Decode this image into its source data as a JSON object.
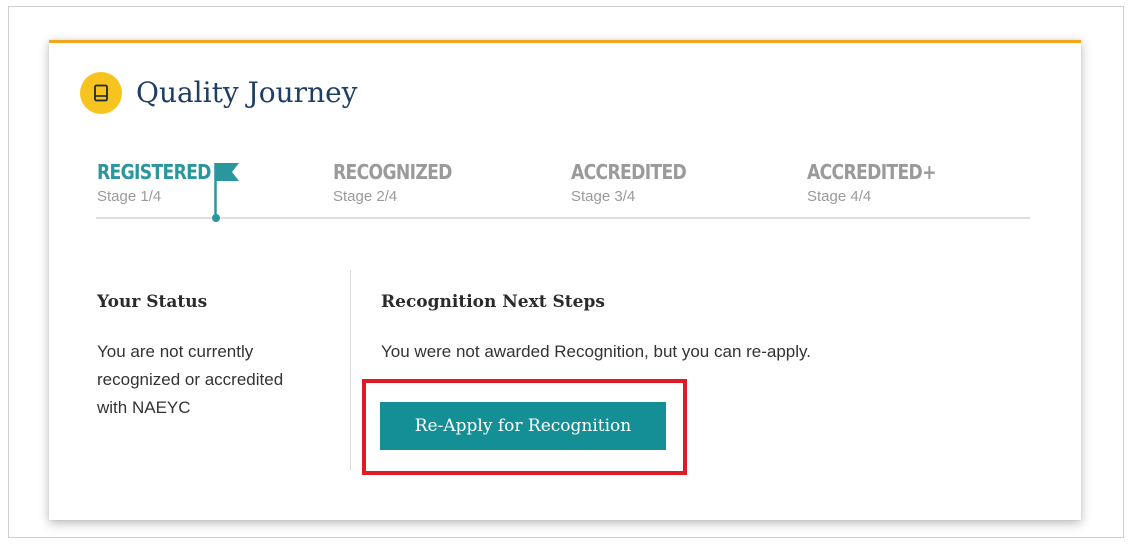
{
  "header": {
    "title": "Quality Journey",
    "icon": "book-icon"
  },
  "stages": [
    {
      "name": "REGISTERED",
      "sub": "Stage 1/4",
      "active": true
    },
    {
      "name": "RECOGNIZED",
      "sub": "Stage 2/4",
      "active": false
    },
    {
      "name": "ACCREDITED",
      "sub": "Stage 3/4",
      "active": false
    },
    {
      "name": "ACCREDITED+",
      "sub": "Stage 4/4",
      "active": false
    }
  ],
  "status": {
    "heading": "Your Status",
    "text": "You are not currently recognized or accredited with NAEYC"
  },
  "next_steps": {
    "heading": "Recognition Next Steps",
    "text": "You were not awarded Recognition, but you can re-apply.",
    "button_label": "Re-Apply for Recognition"
  },
  "colors": {
    "accent_gold": "#f2a81d",
    "icon_yellow": "#f7c31f",
    "teal": "#2a969e",
    "button_teal": "#158f96",
    "title_navy": "#1f3e63",
    "inactive_gray": "#9a9a9a",
    "highlight_red": "#e01b24"
  }
}
